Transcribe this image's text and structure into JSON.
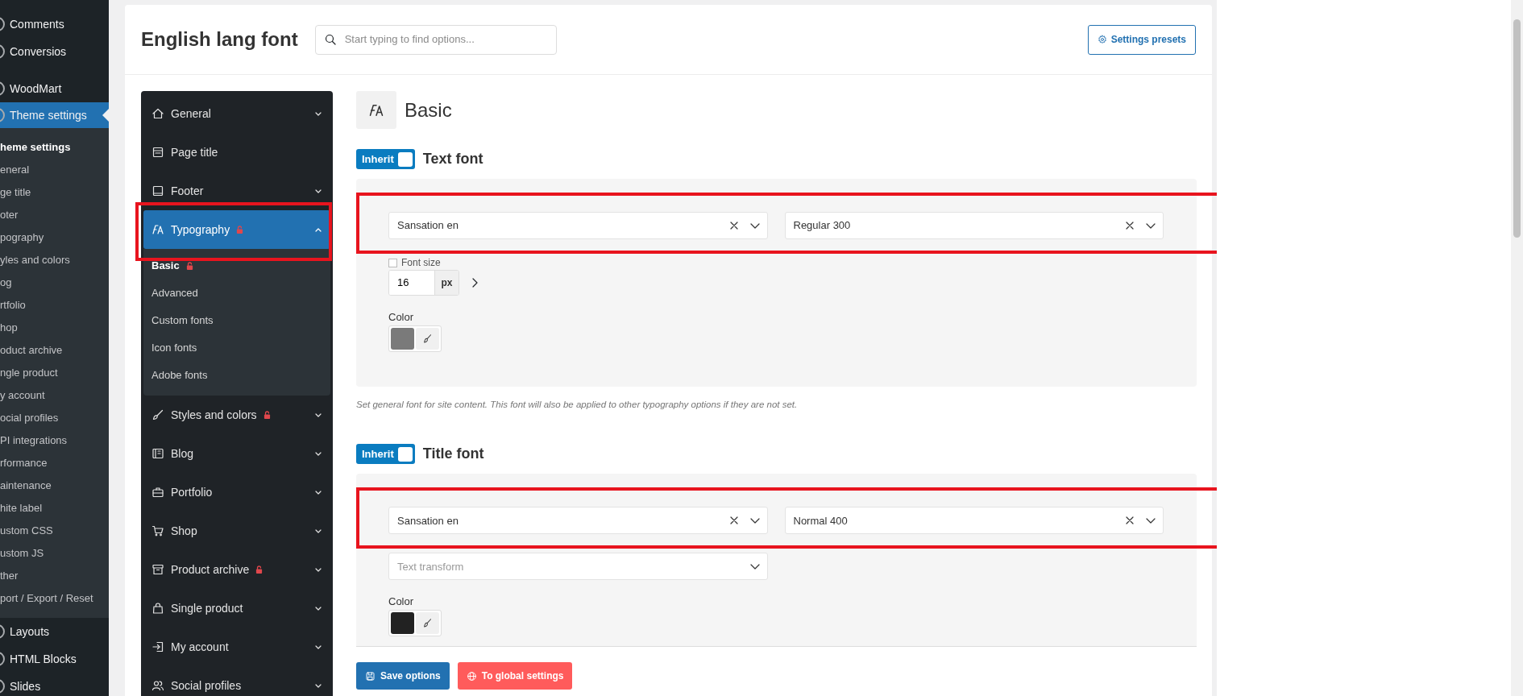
{
  "admin_menu": [
    {
      "label": "Comments",
      "selected": false
    },
    {
      "label": "Conversios",
      "selected": false
    },
    {
      "label": "WoodMart",
      "selected": false,
      "group_start": true
    },
    {
      "label": "Theme settings",
      "selected": true,
      "submenu": [
        {
          "label": "heme settings",
          "selected": true
        },
        {
          "label": "eneral",
          "selected": false
        },
        {
          "label": "ge title",
          "selected": false
        },
        {
          "label": "oter",
          "selected": false
        },
        {
          "label": "pography",
          "selected": false
        },
        {
          "label": "yles and colors",
          "selected": false
        },
        {
          "label": "og",
          "selected": false
        },
        {
          "label": "rtfolio",
          "selected": false
        },
        {
          "label": "hop",
          "selected": false
        },
        {
          "label": "oduct archive",
          "selected": false
        },
        {
          "label": "ngle product",
          "selected": false
        },
        {
          "label": "y account",
          "selected": false
        },
        {
          "label": "ocial profiles",
          "selected": false
        },
        {
          "label": "PI integrations",
          "selected": false
        },
        {
          "label": "rformance",
          "selected": false
        },
        {
          "label": "aintenance",
          "selected": false
        },
        {
          "label": "hite label",
          "selected": false
        },
        {
          "label": "ustom CSS",
          "selected": false
        },
        {
          "label": "ustom JS",
          "selected": false
        },
        {
          "label": "ther",
          "selected": false
        },
        {
          "label": "port / Export / Reset",
          "selected": false
        }
      ]
    },
    {
      "label": "Layouts",
      "selected": false
    },
    {
      "label": "HTML Blocks",
      "selected": false
    },
    {
      "label": "Slides",
      "selected": false
    }
  ],
  "header": {
    "title": "English lang font",
    "search": {
      "placeholder": "Start typing to find options..."
    },
    "presets_button": {
      "label": "Settings presets"
    }
  },
  "settings_nav": [
    {
      "label": "General",
      "selected": false,
      "expanded": false
    },
    {
      "label": "Page title",
      "selected": false
    },
    {
      "label": "Footer",
      "selected": false,
      "expanded": false
    },
    {
      "label": "Typography",
      "locked": true,
      "selected": true,
      "expanded": true,
      "highlighted": true,
      "children": [
        {
          "label": "Basic",
          "selected": true,
          "locked": true
        },
        {
          "label": "Advanced",
          "selected": false
        },
        {
          "label": "Custom fonts",
          "selected": false
        },
        {
          "label": "Icon fonts",
          "selected": false
        },
        {
          "label": "Adobe fonts",
          "selected": false
        }
      ]
    },
    {
      "label": "Styles and colors",
      "locked": true,
      "selected": false,
      "expanded": false
    },
    {
      "label": "Blog",
      "selected": false,
      "expanded": false
    },
    {
      "label": "Portfolio",
      "selected": false,
      "expanded": false
    },
    {
      "label": "Shop",
      "selected": false,
      "expanded": false
    },
    {
      "label": "Product archive",
      "locked": true,
      "selected": false,
      "expanded": false
    },
    {
      "label": "Single product",
      "selected": false,
      "expanded": false
    },
    {
      "label": "My account",
      "selected": false,
      "expanded": false
    },
    {
      "label": "Social profiles",
      "selected": false,
      "expanded": false
    }
  ],
  "section": {
    "title": "Basic"
  },
  "fonts": [
    {
      "label": "Text font",
      "inherit": {
        "label": "Inherit",
        "on": true
      },
      "highlighted": true,
      "family": "Sansation en",
      "weight": "Regular 300",
      "font_size": {
        "label": "Font size",
        "checked": false,
        "value": "16",
        "unit": "px"
      },
      "color": {
        "label": "Color",
        "color": "#7a7a7a"
      },
      "description": "Set general font for site content. This font will also be applied to other typography options if they are not set."
    },
    {
      "label": "Title font",
      "inherit": {
        "label": "Inherit",
        "on": true
      },
      "highlighted": true,
      "family": "Sansation en",
      "weight": "Normal 400",
      "text_transform": {
        "placeholder": "Text transform"
      },
      "color": {
        "label": "Color",
        "color": "#222222"
      }
    }
  ],
  "footer_buttons": [
    {
      "label": "Save options",
      "kind": "save"
    },
    {
      "label": "To global settings",
      "kind": "global"
    }
  ]
}
